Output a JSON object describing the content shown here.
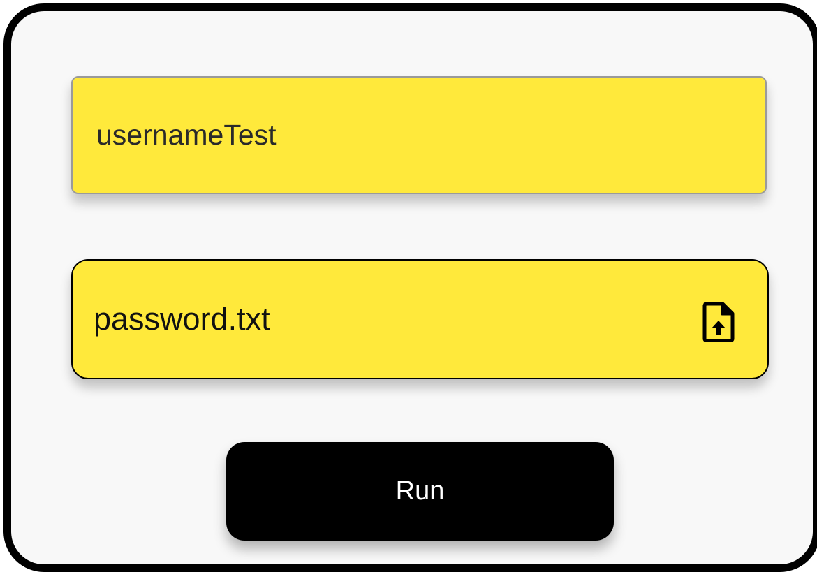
{
  "form": {
    "username": {
      "value": "usernameTest"
    },
    "password_file": {
      "value": "password.txt",
      "icon": "file-upload-icon"
    },
    "run_button": {
      "label": "Run"
    }
  },
  "colors": {
    "field_background": "#ffe93b",
    "button_background": "#000000",
    "button_text": "#ffffff",
    "panel_background": "#f8f8f8",
    "frame_border": "#000000"
  }
}
